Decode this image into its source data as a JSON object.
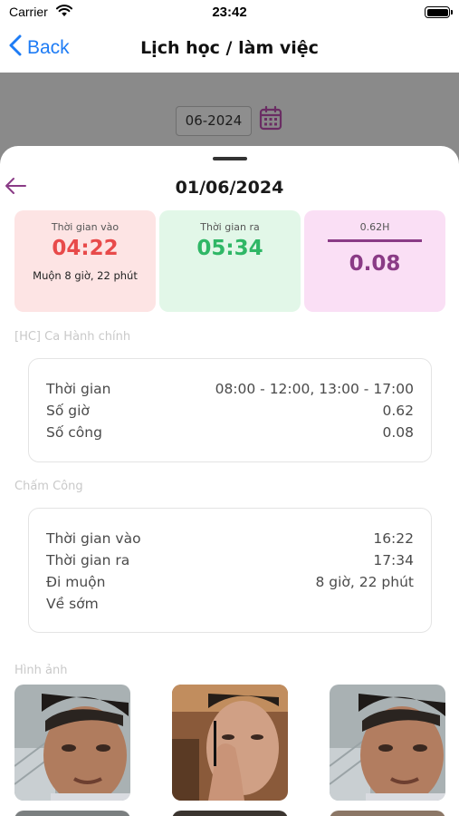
{
  "status_bar": {
    "carrier": "Carrier",
    "time": "23:42"
  },
  "nav": {
    "back_label": "Back",
    "title": "Lịch học / làm việc"
  },
  "month_picker": {
    "value": "06-2024"
  },
  "sheet": {
    "date": "01/06/2024",
    "cards": {
      "check_in": {
        "label": "Thời gian vào",
        "value": "04:22",
        "note": "Muộn 8 giờ, 22 phút"
      },
      "check_out": {
        "label": "Thời gian ra",
        "value": "05:34"
      },
      "hours": {
        "label": "0.62H",
        "value": "0.08"
      }
    },
    "shift": {
      "title": "[HC] Ca Hành chính",
      "rows": [
        {
          "key": "Thời gian",
          "value": "08:00 - 12:00, 13:00 - 17:00"
        },
        {
          "key": "Số giờ",
          "value": "0.62"
        },
        {
          "key": "Số công",
          "value": "0.08"
        }
      ]
    },
    "attendance": {
      "title": "Chấm Công",
      "rows": [
        {
          "key": "Thời gian vào",
          "value": "16:22"
        },
        {
          "key": "Thời gian ra",
          "value": "17:34"
        },
        {
          "key": "Đi muộn",
          "value": "8 giờ, 22 phút"
        },
        {
          "key": "Về sớm",
          "value": ""
        }
      ]
    },
    "images": {
      "title": "Hình ảnh"
    }
  },
  "colors": {
    "accent_blue": "#1e7cf5",
    "late_red": "#e84a4a",
    "out_green": "#2fb766",
    "hours_purple": "#8a3b86"
  },
  "icons": [
    "wifi-icon",
    "battery-icon",
    "chevron-left-icon",
    "calendar-icon",
    "arrow-left-icon"
  ]
}
